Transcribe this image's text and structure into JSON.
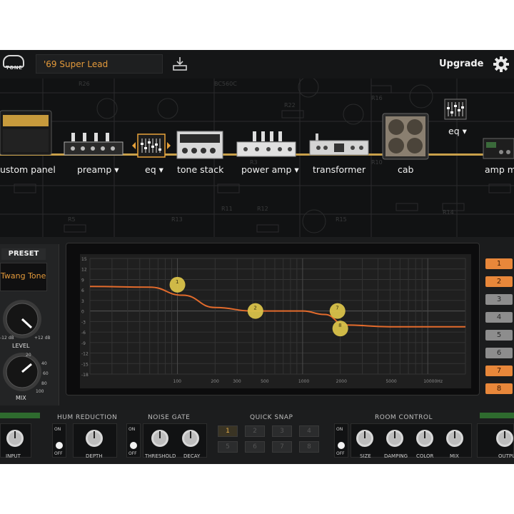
{
  "topbar": {
    "logo_text": "TONE",
    "preset_name": "'69 Super Lead",
    "upgrade_label": "Upgrade"
  },
  "chain": {
    "schematic_labels": [
      "BC560C",
      "R26",
      "R22",
      "R16",
      "R3",
      "R11",
      "R12",
      "R10",
      "R14",
      "R13",
      "R5",
      "R15"
    ],
    "modules": [
      {
        "label": "ustom panel",
        "has_dropdown": false
      },
      {
        "label": "preamp",
        "has_dropdown": true
      },
      {
        "label": "eq",
        "has_dropdown": true
      },
      {
        "label": "tone stack",
        "has_dropdown": false
      },
      {
        "label": "power amp",
        "has_dropdown": true
      },
      {
        "label": "transformer",
        "has_dropdown": false
      },
      {
        "label": "cab",
        "has_dropdown": false
      },
      {
        "label": "eq",
        "has_dropdown": true
      },
      {
        "label": "amp m",
        "has_dropdown": false
      }
    ]
  },
  "eq_panel": {
    "preset_label": "PRESET",
    "preset_value": "Twang Tone",
    "level_label": "LEVEL",
    "level_min": "-12 dB",
    "level_max": "+12 dB",
    "mix_label": "MIX",
    "mix_scale": [
      "20",
      "40",
      "60",
      "80",
      "100"
    ],
    "graph": {
      "y_ticks": [
        "15",
        "12",
        "9",
        "6",
        "3",
        "0",
        "-3",
        "-6",
        "-9",
        "-12",
        "-15",
        "-18"
      ],
      "x_ticks": [
        "100",
        "200",
        "300",
        "500",
        "1000",
        "2000",
        "5000",
        "10000Hz"
      ],
      "curve": [
        [
          20,
          7
        ],
        [
          60,
          6.8
        ],
        [
          110,
          4.5
        ],
        [
          200,
          1
        ],
        [
          400,
          0
        ],
        [
          1000,
          0
        ],
        [
          1500,
          -1
        ],
        [
          2200,
          -4
        ],
        [
          5000,
          -4.5
        ],
        [
          20000,
          -4.5
        ]
      ],
      "nodes": [
        {
          "label": "1",
          "freq": 100,
          "gain": 7.5
        },
        {
          "label": "2",
          "freq": 420,
          "gain": 0
        },
        {
          "label": "7",
          "freq": 1900,
          "gain": 0
        },
        {
          "label": "8",
          "freq": 2000,
          "gain": -5
        }
      ],
      "curve_color": "#e36b2c",
      "node_color": "#d9c24a"
    },
    "bands": [
      {
        "label": "1",
        "active": true
      },
      {
        "label": "2",
        "active": true
      },
      {
        "label": "3",
        "active": false
      },
      {
        "label": "4",
        "active": false
      },
      {
        "label": "5",
        "active": false
      },
      {
        "label": "6",
        "active": false
      },
      {
        "label": "7",
        "active": true
      },
      {
        "label": "8",
        "active": true
      }
    ]
  },
  "bottom": {
    "hum_reduction": "HUM REDUCTION",
    "noise_gate": "NOISE GATE",
    "quick_snap": "QUICK SNAP",
    "room_control": "ROOM CONTROL",
    "on": "ON",
    "off": "OFF",
    "knobs": {
      "input": "INPUT",
      "depth": "DEPTH",
      "threshold": "THRESHOLD",
      "decay": "DECAY",
      "size": "SIZE",
      "damping": "DAMPING",
      "color": "COLOR",
      "mix": "MIX",
      "output": "OUTPU"
    },
    "snaps": [
      "1",
      "2",
      "3",
      "4",
      "5",
      "6",
      "7",
      "8"
    ],
    "active_snap": "1"
  }
}
